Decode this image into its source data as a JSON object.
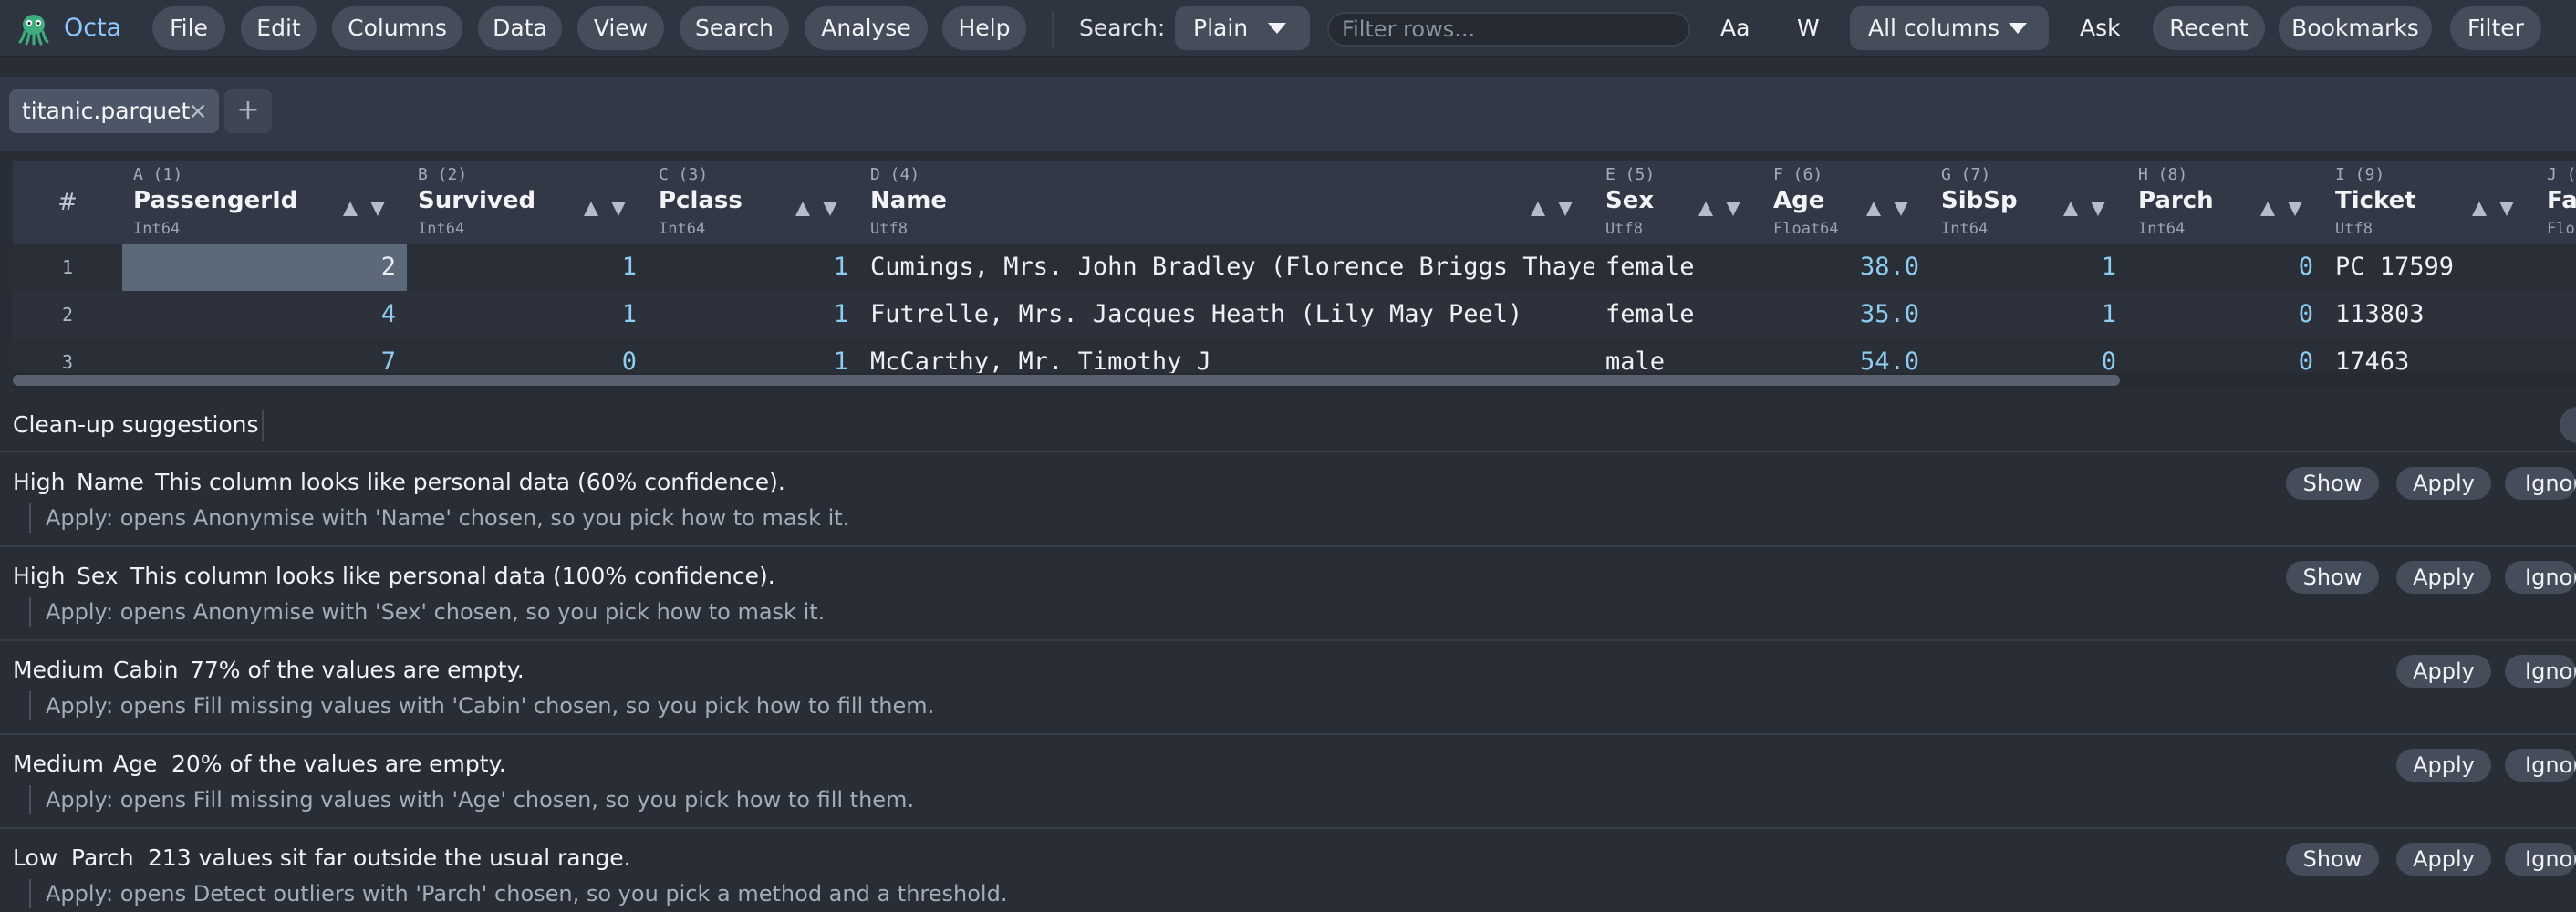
{
  "app": {
    "name": "Octa"
  },
  "menu": [
    "File",
    "Edit",
    "Columns",
    "Data",
    "View",
    "Search",
    "Analyse",
    "Help"
  ],
  "search": {
    "label": "Search:",
    "mode": "Plain",
    "placeholder": "Filter rows...",
    "case_label": "Aa",
    "word_label": "W",
    "scope": "All columns"
  },
  "toolbar": [
    "Ask",
    "Recent",
    "Bookmarks",
    "Filter"
  ],
  "tabs": {
    "file": "titanic.parquet",
    "close": "×",
    "add": "+"
  },
  "grid": {
    "rownum_header": "#",
    "columns": [
      {
        "letter": "A (1)",
        "name": "PassengerId",
        "type": "Int64"
      },
      {
        "letter": "B (2)",
        "name": "Survived",
        "type": "Int64"
      },
      {
        "letter": "C (3)",
        "name": "Pclass",
        "type": "Int64"
      },
      {
        "letter": "D (4)",
        "name": "Name",
        "type": "Utf8"
      },
      {
        "letter": "E (5)",
        "name": "Sex",
        "type": "Utf8"
      },
      {
        "letter": "F (6)",
        "name": "Age",
        "type": "Float64"
      },
      {
        "letter": "G (7)",
        "name": "SibSp",
        "type": "Int64"
      },
      {
        "letter": "H (8)",
        "name": "Parch",
        "type": "Int64"
      },
      {
        "letter": "I (9)",
        "name": "Ticket",
        "type": "Utf8"
      },
      {
        "letter": "J (",
        "name": "Far",
        "type": "Flo"
      }
    ],
    "rows": [
      {
        "n": "1",
        "cells": [
          "2",
          "1",
          "1",
          "Cumings, Mrs. John Bradley (Florence Briggs Thayer",
          "female",
          "38.0",
          "1",
          "0",
          "PC 17599"
        ]
      },
      {
        "n": "2",
        "cells": [
          "4",
          "1",
          "1",
          "Futrelle, Mrs. Jacques Heath (Lily May Peel)",
          "female",
          "35.0",
          "1",
          "0",
          "113803"
        ]
      },
      {
        "n": "3",
        "cells": [
          "7",
          "0",
          "1",
          "McCarthy, Mr. Timothy J",
          "male",
          "54.0",
          "0",
          "0",
          "17463"
        ]
      }
    ]
  },
  "suggestions": {
    "title": "Clean-up suggestions",
    "items": [
      {
        "severity": "High",
        "column": "Name",
        "text": "This column looks like personal data (60% confidence).",
        "hint": "Apply: opens Anonymise with 'Name' chosen, so you pick how to mask it.",
        "show": "Show",
        "apply": "Apply",
        "ignore": "Ignore"
      },
      {
        "severity": "High",
        "column": "Sex",
        "text": "This column looks like personal data (100% confidence).",
        "hint": "Apply: opens Anonymise with 'Sex' chosen, so you pick how to mask it.",
        "show": "Show",
        "apply": "Apply",
        "ignore": "Ignore"
      },
      {
        "severity": "Medium",
        "column": "Cabin",
        "text": "77% of the values are empty.",
        "hint": "Apply: opens Fill missing values with 'Cabin' chosen, so you pick how to fill them.",
        "apply": "Apply",
        "ignore": "Ignore"
      },
      {
        "severity": "Medium",
        "column": "Age",
        "text": "20% of the values are empty.",
        "hint": "Apply: opens Fill missing values with 'Age' chosen, so you pick how to fill them.",
        "apply": "Apply",
        "ignore": "Ignore"
      },
      {
        "severity": "Low",
        "column": "Parch",
        "text": "213 values sit far outside the usual range.",
        "hint": "Apply: opens Detect outliers with 'Parch' chosen, so you pick a method and a threshold.",
        "show": "Show",
        "apply": "Apply",
        "ignore": "Ignore"
      }
    ]
  },
  "colors": {
    "accent": "#8fc7ff",
    "number": "#8fcdf0",
    "background": "#282d36",
    "pill": "#454d5a"
  },
  "icons": {
    "logo": "octopus-logo-icon",
    "close": "close-icon",
    "add": "plus-icon",
    "dropdown": "chevron-down-icon",
    "sort_up": "sort-ascending-icon",
    "sort_down": "sort-descending-icon"
  }
}
